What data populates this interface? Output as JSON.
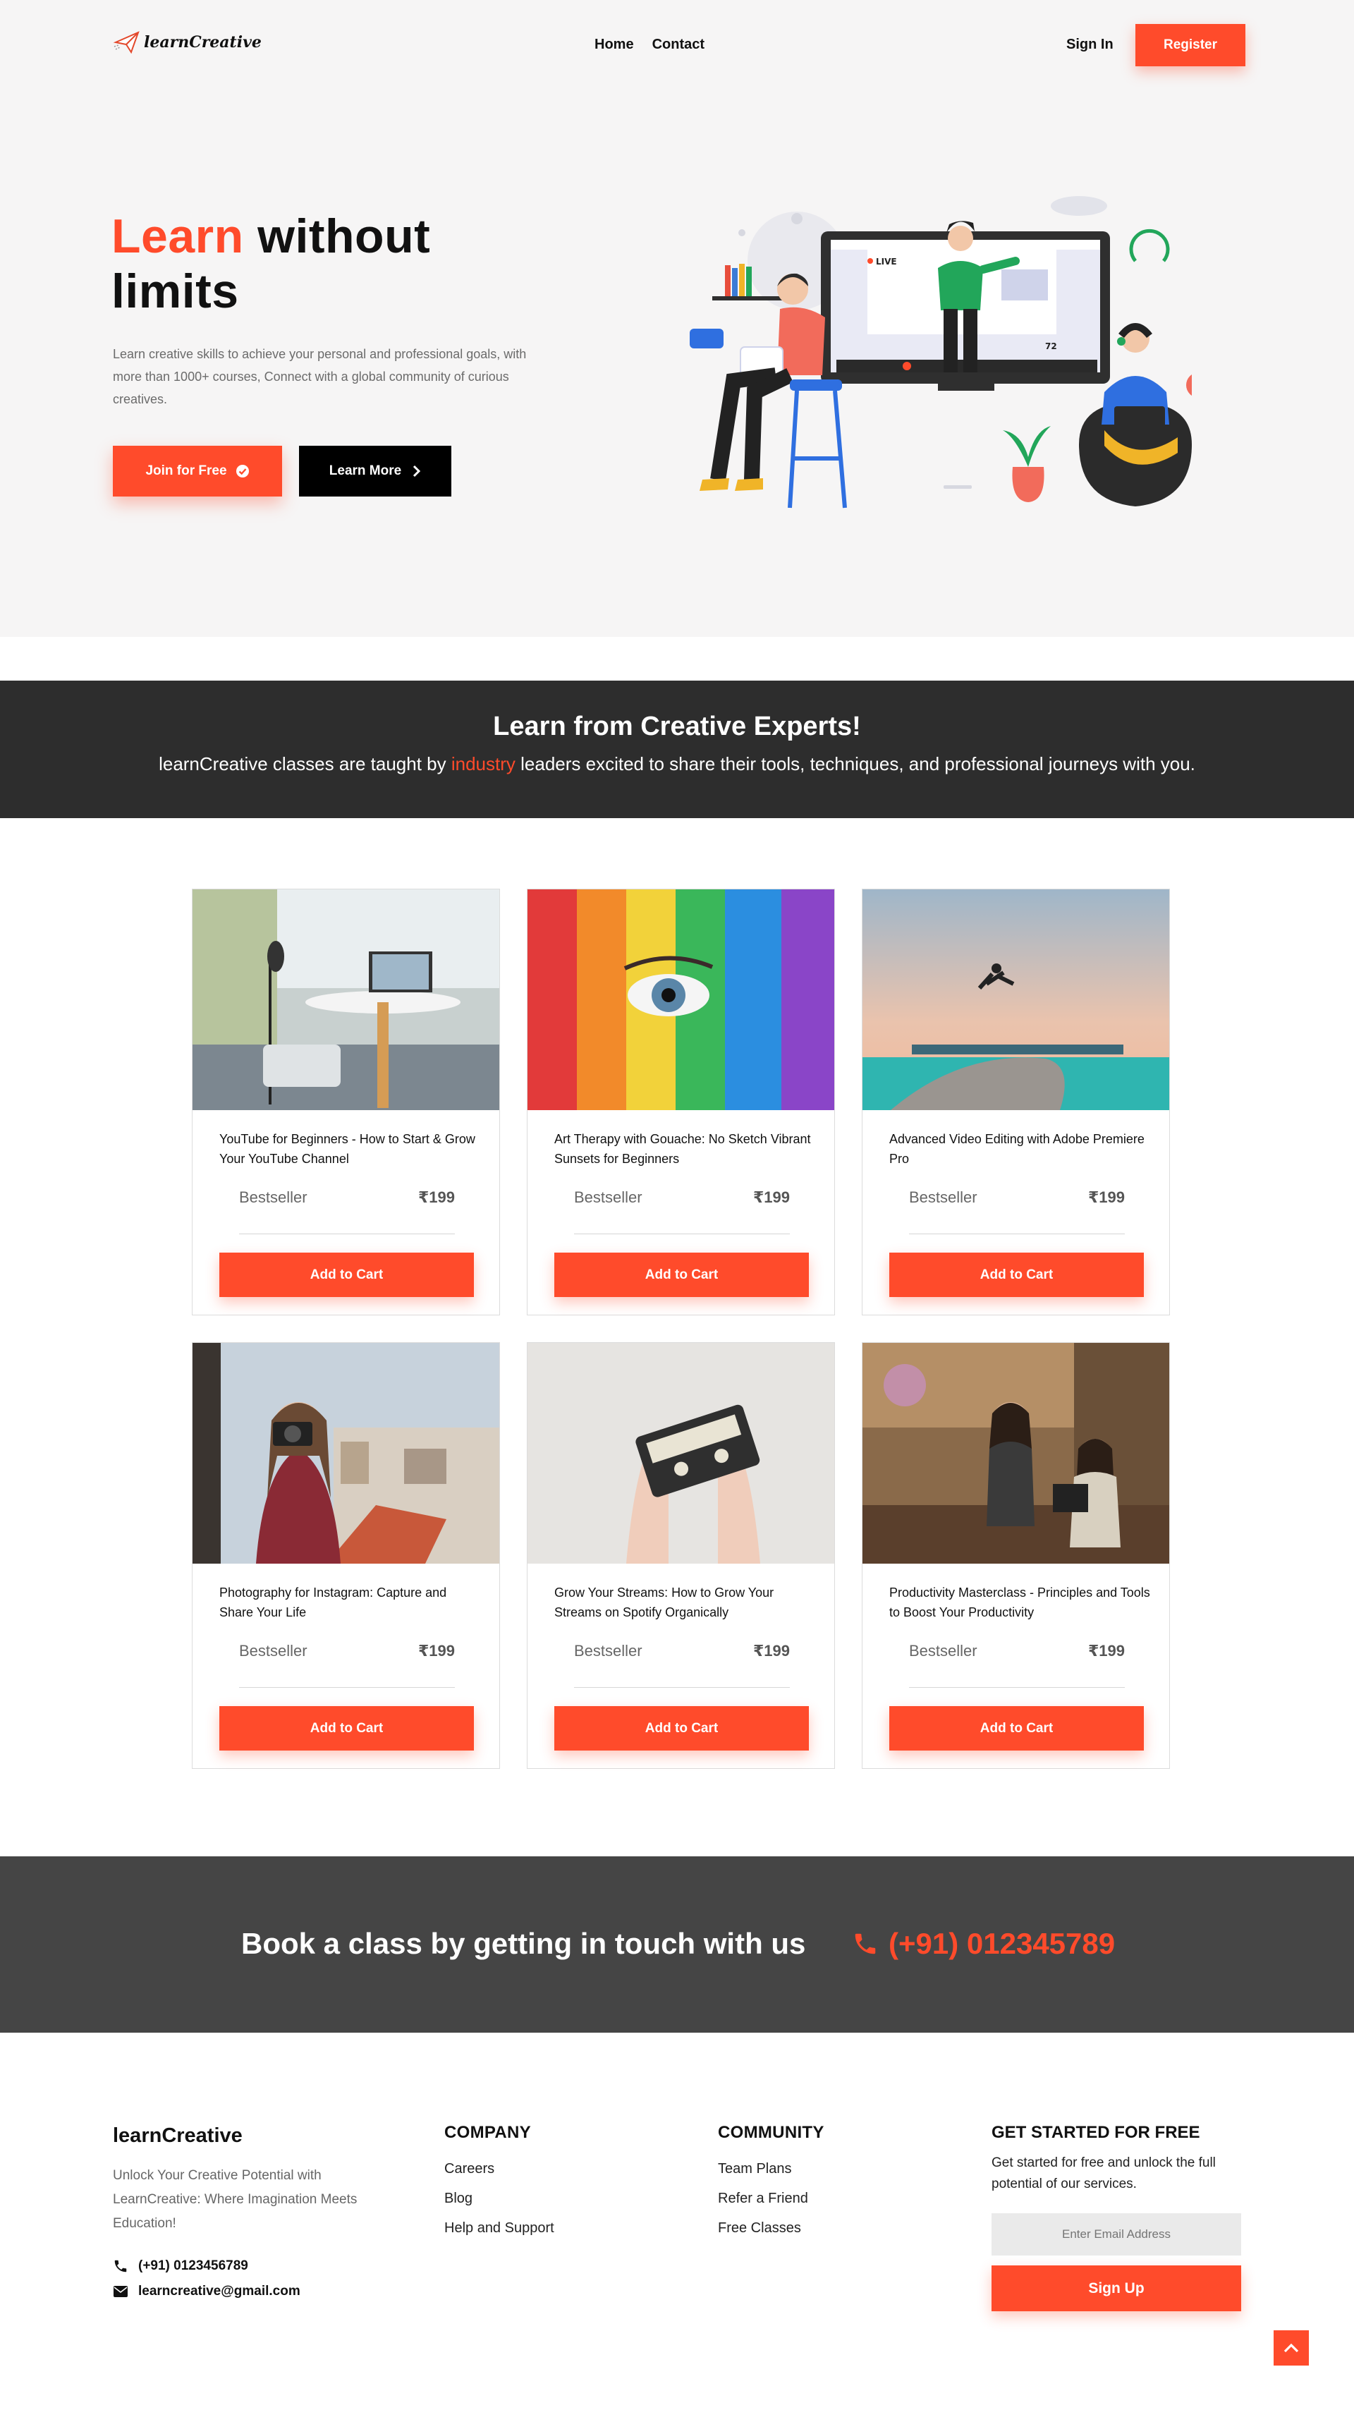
{
  "header": {
    "logo_text": "learnCreative",
    "nav": [
      "Home",
      "Contact"
    ],
    "signin": "Sign In",
    "register": "Register"
  },
  "hero": {
    "title_accent": "Learn",
    "title_rest_1": " without",
    "title_rest_2": "limits",
    "description": "Learn creative skills to achieve your personal and professional goals, with more than 1000+ courses, Connect with a global community of curious creatives.",
    "join_button": "Join for Free",
    "learn_button": "Learn More",
    "illustration_live_label": "LIVE",
    "illustration_viewers": "72"
  },
  "experts": {
    "title": "Learn from Creative Experts!",
    "text_before": "learnCreative classes are taught by ",
    "text_accent": "industry",
    "text_after": " leaders excited to share their tools, techniques, and professional journeys with you."
  },
  "courses": [
    {
      "title": "YouTube for Beginners - How to Start & Grow Your YouTube Channel",
      "badge": "Bestseller",
      "price": "₹199",
      "button": "Add to Cart"
    },
    {
      "title": "Art Therapy with Gouache: No Sketch Vibrant Sunsets for Beginners",
      "badge": "Bestseller",
      "price": "₹199",
      "button": "Add to Cart"
    },
    {
      "title": "Advanced Video Editing with Adobe Premiere Pro",
      "badge": "Bestseller",
      "price": "₹199",
      "button": "Add to Cart"
    },
    {
      "title": "Photography for Instagram: Capture and Share Your Life",
      "badge": "Bestseller",
      "price": "₹199",
      "button": "Add to Cart"
    },
    {
      "title": "Grow Your Streams: How to Grow Your Streams on Spotify Organically",
      "badge": "Bestseller",
      "price": "₹199",
      "button": "Add to Cart"
    },
    {
      "title": "Productivity Masterclass - Principles and Tools to Boost Your Productivity",
      "badge": "Bestseller",
      "price": "₹199",
      "button": "Add to Cart"
    }
  ],
  "book": {
    "text": "Book a class by getting in touch with us",
    "phone": "(+91) 012345789"
  },
  "footer": {
    "brand": "learnCreative",
    "tagline": "Unlock Your Creative Potential with LearnCreative: Where Imagination Meets Education!",
    "phone": "(+91) 0123456789",
    "email": "learncreative@gmail.com",
    "company": {
      "title": "COMPANY",
      "links": [
        "Careers",
        "Blog",
        "Help and Support"
      ]
    },
    "community": {
      "title": "COMMUNITY",
      "links": [
        "Team Plans",
        "Refer a Friend",
        "Free Classes"
      ]
    },
    "start": {
      "title": "GET STARTED FOR FREE",
      "text": "Get started for free and unlock the full potential of our services.",
      "email_placeholder": "Enter Email Address",
      "button": "Sign Up"
    }
  },
  "colors": {
    "accent": "#ff4b2b",
    "dark_band": "#2d2d2d",
    "contact_band": "#454545",
    "hero_bg": "#f6f5f5"
  }
}
